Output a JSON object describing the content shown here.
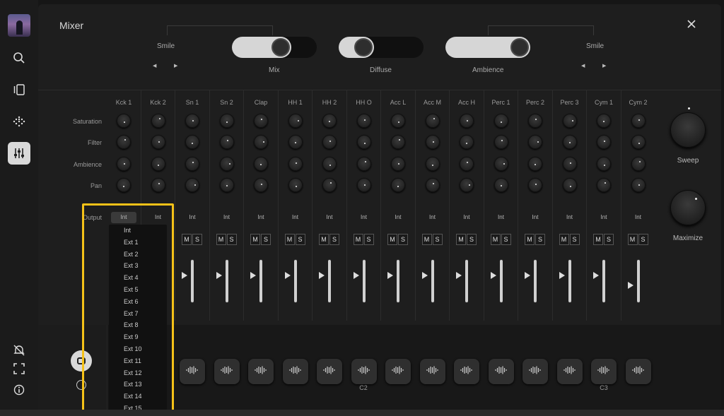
{
  "sidebar": {
    "icons": [
      "artwork-avatar",
      "search-icon",
      "browser-icon",
      "sequencer-icon",
      "mixer-icon",
      "notifications-off-icon",
      "fullscreen-icon",
      "info-icon"
    ]
  },
  "title": "Mixer",
  "top": {
    "left_label": "Smile",
    "right_label": "Smile",
    "mix_label": "Mix",
    "diffuse_label": "Diffuse",
    "ambience_label": "Ambience",
    "arrow_left": "◀",
    "arrow_right": "▶",
    "mix_value": 0.6,
    "diffuse_value": 0.22,
    "ambience_value": 1.0
  },
  "row_labels": [
    "Saturation",
    "Filter",
    "Ambience",
    "Pan"
  ],
  "output_label": "Output",
  "channels": [
    {
      "name": "Kck 1",
      "output": "Int"
    },
    {
      "name": "Kck 2",
      "output": "Int"
    },
    {
      "name": "Sn 1",
      "output": "Int"
    },
    {
      "name": "Sn 2",
      "output": "Int"
    },
    {
      "name": "Clap",
      "output": "Int"
    },
    {
      "name": "HH 1",
      "output": "Int"
    },
    {
      "name": "HH 2",
      "output": "Int"
    },
    {
      "name": "HH O",
      "output": "Int"
    },
    {
      "name": "Acc L",
      "output": "Int"
    },
    {
      "name": "Acc M",
      "output": "Int"
    },
    {
      "name": "Acc H",
      "output": "Int"
    },
    {
      "name": "Perc 1",
      "output": "Int"
    },
    {
      "name": "Perc 2",
      "output": "Int"
    },
    {
      "name": "Perc 3",
      "output": "Int"
    },
    {
      "name": "Cym 1",
      "output": "Int"
    },
    {
      "name": "Cym 2",
      "output": "Int"
    }
  ],
  "mute_label": "M",
  "solo_label": "S",
  "macros": {
    "sweep_label": "Sweep",
    "maximize_label": "Maximize"
  },
  "dropdown": {
    "options": [
      "Int",
      "Ext 1",
      "Ext 2",
      "Ext 3",
      "Ext 4",
      "Ext 5",
      "Ext 6",
      "Ext 7",
      "Ext 8",
      "Ext 9",
      "Ext 10",
      "Ext 11",
      "Ext 12",
      "Ext 13",
      "Ext 14",
      "Ext 15"
    ],
    "selected": "Int"
  },
  "pads": {
    "notes": [
      "C2",
      "C3"
    ]
  },
  "colors": {
    "highlight": "#f5c218",
    "background": "#1e1e1e",
    "knob_indicator": "#eeeeee"
  }
}
